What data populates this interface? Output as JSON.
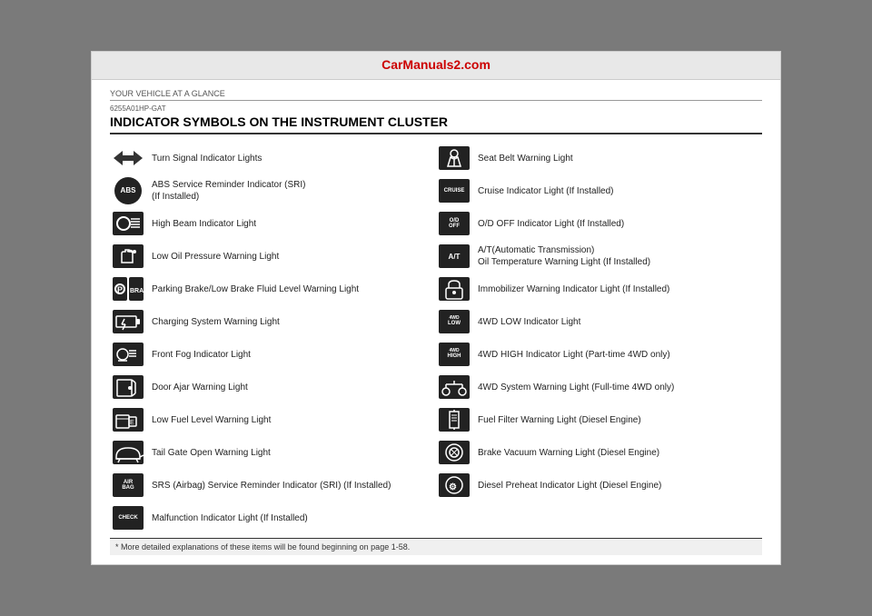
{
  "banner": {
    "url_text": "CarManuals2.com"
  },
  "header": {
    "section_label": "YOUR VEHICLE AT A GLANCE",
    "doc_code": "6255A01HP-GAT",
    "title": "INDICATOR SYMBOLS ON THE INSTRUMENT CLUSTER"
  },
  "left_column": [
    {
      "id": "turn-signal",
      "icon_type": "turn_signal",
      "text": "Turn Signal Indicator Lights"
    },
    {
      "id": "abs",
      "icon_type": "abs",
      "text": "ABS Service Reminder Indicator (SRI)\n(If Installed)"
    },
    {
      "id": "high-beam",
      "icon_type": "high_beam",
      "text": "High Beam Indicator Light"
    },
    {
      "id": "low-oil",
      "icon_type": "low_oil",
      "text": "Low Oil Pressure Warning Light"
    },
    {
      "id": "parking-brake",
      "icon_type": "parking_brake",
      "text": "Parking Brake/Low Brake Fluid Level Warning Light"
    },
    {
      "id": "charging",
      "icon_type": "charging",
      "text": "Charging System Warning Light"
    },
    {
      "id": "front-fog",
      "icon_type": "front_fog",
      "text": "Front Fog Indicator Light"
    },
    {
      "id": "door-ajar",
      "icon_type": "door_ajar",
      "text": "Door Ajar Warning Light"
    },
    {
      "id": "low-fuel",
      "icon_type": "low_fuel",
      "text": "Low Fuel Level Warning Light"
    },
    {
      "id": "tail-gate",
      "icon_type": "tail_gate",
      "text": "Tail Gate Open Warning Light"
    },
    {
      "id": "srs",
      "icon_type": "srs",
      "text": "SRS (Airbag) Service Reminder Indicator (SRI) (If Installed)"
    },
    {
      "id": "malfunction",
      "icon_type": "malfunction",
      "text": "Malfunction Indicator Light  (If Installed)"
    }
  ],
  "right_column": [
    {
      "id": "seat-belt",
      "icon_type": "seat_belt",
      "text": "Seat Belt Warning Light"
    },
    {
      "id": "cruise",
      "icon_type": "cruise",
      "text": "Cruise Indicator Light (If Installed)"
    },
    {
      "id": "od-off",
      "icon_type": "od_off",
      "text": "O/D OFF Indicator Light (If Installed)"
    },
    {
      "id": "at-temp",
      "icon_type": "at_temp",
      "text": "A/T(Automatic Transmission)\nOil Temperature Warning Light (If Installed)"
    },
    {
      "id": "immobilizer",
      "icon_type": "immobilizer",
      "text": "Immobilizer Warning Indicator Light (If Installed)"
    },
    {
      "id": "4wd-low",
      "icon_type": "4wd_low",
      "text": "4WD LOW Indicator Light"
    },
    {
      "id": "4wd-high",
      "icon_type": "4wd_high",
      "text": "4WD HIGH Indicator Light (Part-time 4WD only)"
    },
    {
      "id": "4wd-system",
      "icon_type": "4wd_system",
      "text": "4WD  System Warning Light (Full-time 4WD only)"
    },
    {
      "id": "fuel-filter",
      "icon_type": "fuel_filter",
      "text": "Fuel Filter Warning Light (Diesel Engine)"
    },
    {
      "id": "brake-vacuum",
      "icon_type": "brake_vacuum",
      "text": "Brake Vacuum Warning Light (Diesel Engine)"
    },
    {
      "id": "diesel-preheat",
      "icon_type": "diesel_preheat",
      "text": "Diesel Preheat Indicator Light (Diesel Engine)"
    }
  ],
  "footer": {
    "note": "* More detailed explanations of these items will be found beginning on page 1-58."
  }
}
